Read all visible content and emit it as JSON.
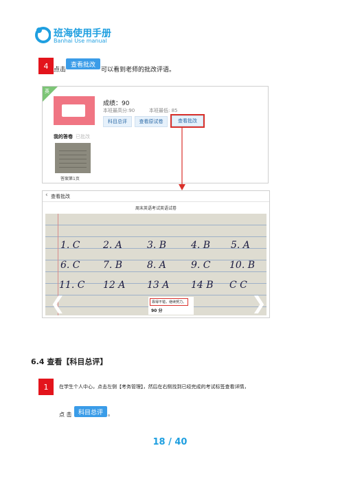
{
  "header": {
    "logo_title": "班海使用手册",
    "logo_subtitle": "Banhai Use manual"
  },
  "step4": {
    "number": "4",
    "prefix": "点击",
    "button": "查看批改",
    "suffix": "可以看到老师的批改评语。"
  },
  "card": {
    "badge": "英",
    "score": "成绩：90",
    "stat_high": "本班最高分:90",
    "stat_low": "本班最低: 85",
    "buttons": [
      "科目总评",
      "查看原试卷",
      "查看批改"
    ],
    "my_answer_label": "我的答卷",
    "my_answer_status": "已批改",
    "thumb_caption": "答案第1页"
  },
  "review": {
    "back_label": "查看批改",
    "exam_title": "周末英语考试英语试卷",
    "answers": [
      [
        "1. C",
        "2. A",
        "3. B",
        "4. B",
        "5. A"
      ],
      [
        "6. C",
        "7. B",
        "8. A",
        "9. C",
        "10. B"
      ],
      [
        "11. C",
        "12 A",
        "13 A",
        "14 B",
        "C  C"
      ]
    ],
    "comment": "靠得不错，继续努力。",
    "score": "90 分",
    "prev_arrow": "❮",
    "next_arrow": "❯"
  },
  "section": {
    "title": "6.4  查看【科目总评】"
  },
  "step1": {
    "number": "1",
    "text": "在学生个人中心，点击左侧【考务管理】，然后在右侧找到已经完成的考试标签查看详情，",
    "prefix": "点 击",
    "button": "科目总评",
    "suffix": "。"
  },
  "page_number": "18 / 40",
  "colors": {
    "accent": "#1f9fe0",
    "step": "#e3141c",
    "badge": "#7cc576",
    "highlight": "#d9302a"
  }
}
